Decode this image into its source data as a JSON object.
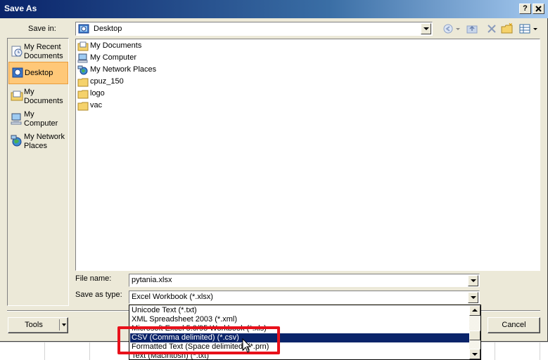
{
  "window": {
    "title": "Save As",
    "help_label": "?",
    "close_label": "X"
  },
  "save_in": {
    "label": "Save in:",
    "value": "Desktop"
  },
  "places": [
    {
      "label": "My Recent Documents",
      "icon": "recent-documents-icon"
    },
    {
      "label": "Desktop",
      "icon": "desktop-icon",
      "active": true
    },
    {
      "label": "My Documents",
      "icon": "my-documents-icon"
    },
    {
      "label": "My Computer",
      "icon": "my-computer-icon"
    },
    {
      "label": "My Network Places",
      "icon": "network-places-icon"
    }
  ],
  "files": [
    {
      "name": "My Documents",
      "icon": "my-documents-icon"
    },
    {
      "name": "My Computer",
      "icon": "my-computer-icon"
    },
    {
      "name": "My Network Places",
      "icon": "network-places-icon"
    },
    {
      "name": "cpuz_150",
      "icon": "folder-icon"
    },
    {
      "name": "logo",
      "icon": "folder-icon"
    },
    {
      "name": "vac",
      "icon": "folder-icon"
    }
  ],
  "file_name": {
    "label": "File name:",
    "value": "pytania.xlsx"
  },
  "save_as_type": {
    "label": "Save as type:",
    "value": "Excel Workbook (*.xlsx)",
    "options": [
      "Unicode Text (*.txt)",
      "XML Spreadsheet 2003 (*.xml)",
      "Microsoft Excel 5.0/95 Workbook (*.xls)",
      "CSV (Comma delimited) (*.csv)",
      "Formatted Text (Space delimited) (*.prn)",
      "Text (Macintosh) (*.txt)"
    ],
    "selected_index": 3
  },
  "buttons": {
    "tools": "Tools",
    "cancel": "Cancel"
  },
  "colors": {
    "title_bar": "#0a246a",
    "selection": "#0a246a",
    "annotation_box": "#e8111b",
    "active_place": "#ffc878"
  }
}
